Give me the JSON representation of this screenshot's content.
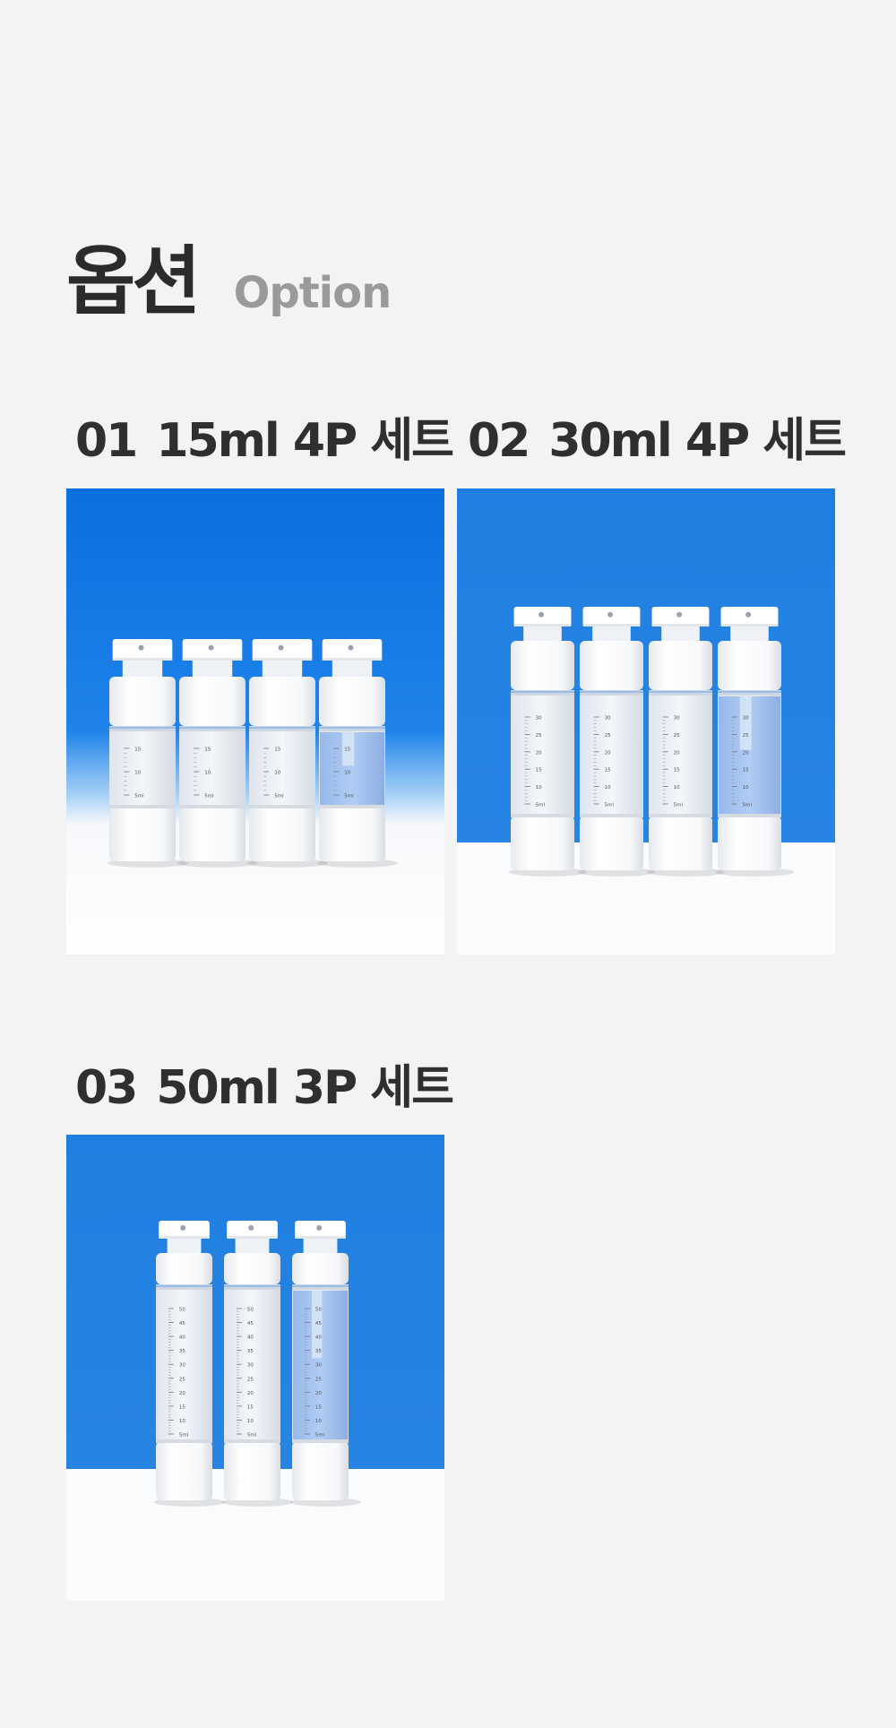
{
  "heading": {
    "title_ko": "옵션",
    "title_en": "Option"
  },
  "options": [
    {
      "number": "01",
      "name": "15ml 4P 세트",
      "image_alt": "15ml 4P 세트",
      "scale": [
        "15",
        "10",
        "5ml"
      ],
      "scale_filled": [
        "15",
        "10",
        "5ml"
      ]
    },
    {
      "number": "02",
      "name": "30ml 4P 세트",
      "image_alt": "30ml 4P 세트",
      "scale": [
        "30",
        "25",
        "20",
        "15",
        "10",
        "5ml"
      ],
      "scale_filled": [
        "30",
        "25",
        "20",
        "15",
        "10",
        "5ml"
      ]
    },
    {
      "number": "03",
      "name": "50ml 3P 세트",
      "image_alt": "50ml 3P 세트",
      "scale": [
        "50",
        "45",
        "40",
        "35",
        "30",
        "25",
        "20",
        "15",
        "10",
        "5ml"
      ],
      "scale_filled": [
        "50",
        "45",
        "40",
        "35",
        "30",
        "25",
        "20",
        "15",
        "10",
        "5ml"
      ]
    }
  ],
  "colors": {
    "page_bg": "#f3f3f4",
    "backdrop_blue": "#1f7fe0",
    "liquid_blue": "#a9c8f2",
    "bottle_white": "#ffffff"
  }
}
